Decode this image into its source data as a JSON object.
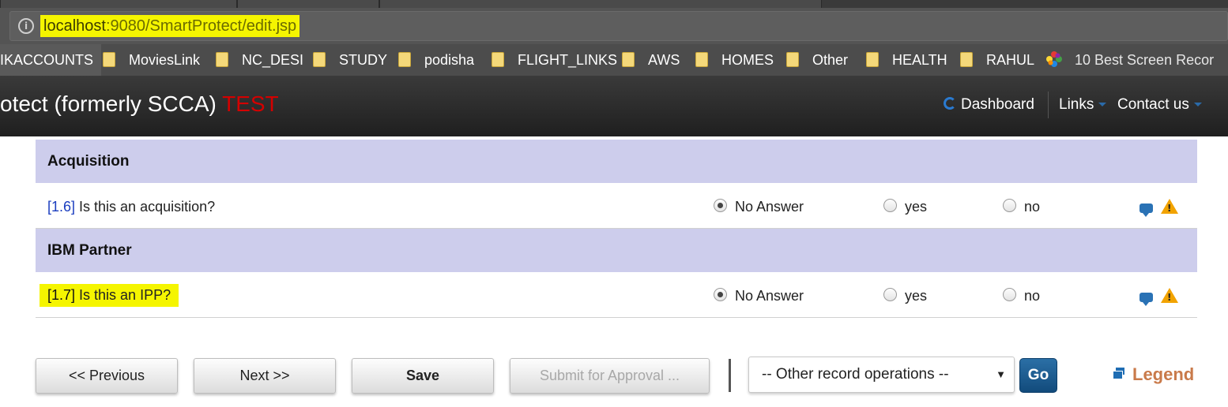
{
  "browser": {
    "url_host": "localhost",
    "url_rest": ":9080/SmartProtect/edit.jsp",
    "bookmarks": [
      {
        "label": "IKACCOUNTS",
        "icon": "none"
      },
      {
        "label": "MoviesLink",
        "icon": "folder-icon"
      },
      {
        "label": "NC_DESI",
        "icon": "folder-icon"
      },
      {
        "label": "STUDY",
        "icon": "folder-icon"
      },
      {
        "label": "podisha",
        "icon": "folder-icon"
      },
      {
        "label": "FLIGHT_LINKS",
        "icon": "folder-icon"
      },
      {
        "label": "AWS",
        "icon": "folder-icon"
      },
      {
        "label": "HOMES",
        "icon": "folder-icon"
      },
      {
        "label": "Other",
        "icon": "folder-icon"
      },
      {
        "label": "HEALTH",
        "icon": "folder-icon"
      },
      {
        "label": "RAHUL",
        "icon": "folder-icon"
      },
      {
        "label": "10 Best Screen Recor",
        "icon": "pinwheel-icon"
      }
    ]
  },
  "header": {
    "title": "otect (formerly SCCA) ",
    "env_tag": "TEST",
    "env_color": "#d40000",
    "nav": {
      "dashboard": "Dashboard",
      "links": "Links",
      "contact": "Contact us"
    }
  },
  "sections": [
    {
      "title": "Acquisition",
      "question": {
        "num": "[1.6]",
        "text": " Is this an acquisition?",
        "highlighted": false,
        "selected": "No Answer"
      }
    },
    {
      "title": "IBM Partner",
      "question": {
        "num": "[1.7]",
        "text": " Is this an IPP?",
        "highlighted": true,
        "selected": "No Answer"
      }
    }
  ],
  "radio_options": {
    "no_answer": "No Answer",
    "yes": "yes",
    "no": "no"
  },
  "toolbar": {
    "previous": "<< Previous",
    "next": "Next >>",
    "save": "Save",
    "submit": "Submit for Approval ...",
    "record_ops": "-- Other record operations --",
    "go": "Go",
    "legend": "Legend"
  },
  "colors": {
    "section_bg": "#cdcdec",
    "highlight": "#f5f500",
    "question_num": "#1a3dbf",
    "go_button": "#1c5a8e",
    "legend_text": "#c97a4a"
  }
}
